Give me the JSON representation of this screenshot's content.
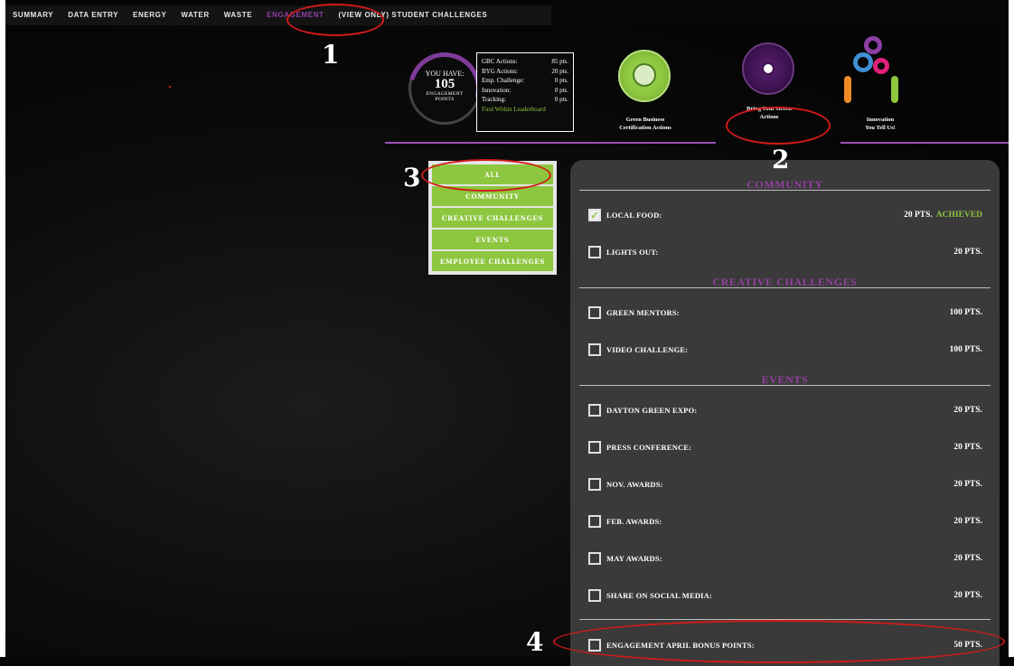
{
  "nav": {
    "tabs": [
      "SUMMARY",
      "DATA ENTRY",
      "ENERGY",
      "WATER",
      "WASTE",
      "ENGAGEMENT",
      "(VIEW ONLY) STUDENT CHALLENGES"
    ],
    "active_tab": "ENGAGEMENT"
  },
  "annotations": [
    "1",
    "2",
    "3",
    "4"
  ],
  "score": {
    "you_have": "YOU HAVE:",
    "points": "105",
    "unit_line1": "ENGAGEMENT",
    "unit_line2": "POINTS",
    "arc_fraction": 0.25
  },
  "breakdown": [
    {
      "label": "GBC Actions:",
      "value": "85 pts."
    },
    {
      "label": "BYG Actions:",
      "value": "20 pts."
    },
    {
      "label": "Emp. Challenge:",
      "value": "0 pts."
    },
    {
      "label": "Innovation:",
      "value": "0 pts."
    },
    {
      "label": "Tracking:",
      "value": "0 pts."
    }
  ],
  "leaderboard_link": "Find Within Leaderboard",
  "categories": [
    {
      "line1": "Green Business",
      "line2": "Certification Actions"
    },
    {
      "line1": "Bring Your Green",
      "line2": "Actions"
    },
    {
      "line1": "Innovation",
      "line2": "You Tell Us!"
    }
  ],
  "filters": [
    "ALL",
    "COMMUNITY",
    "CREATIVE CHALLENGES",
    "EVENTS",
    "EMPLOYEE CHALLENGES"
  ],
  "sections": {
    "community": {
      "title": "COMMUNITY",
      "items": [
        {
          "label": "LOCAL FOOD:",
          "pts": "20 PTS.",
          "status": "ACHIEVED",
          "checked": true
        },
        {
          "label": "LIGHTS OUT:",
          "pts": "20 PTS."
        }
      ]
    },
    "creative": {
      "title": "CREATIVE CHALLENGES",
      "items": [
        {
          "label": "GREEN MENTORS:",
          "pts": "100 PTS."
        },
        {
          "label": "VIDEO CHALLENGE:",
          "pts": "100 PTS."
        }
      ]
    },
    "events": {
      "title": "EVENTS",
      "items": [
        {
          "label": "DAYTON GREEN EXPO:",
          "pts": "20 PTS."
        },
        {
          "label": "PRESS CONFERENCE:",
          "pts": "20 PTS."
        },
        {
          "label": "NOV. AWARDS:",
          "pts": "20 PTS."
        },
        {
          "label": "FEB. AWARDS:",
          "pts": "20 PTS."
        },
        {
          "label": "MAY AWARDS:",
          "pts": "20 PTS."
        },
        {
          "label": "SHARE ON SOCIAL MEDIA:",
          "pts": "20 PTS."
        },
        {
          "label": "ENGAGEMENT APRIL BONUS POINTS:",
          "pts": "50 PTS."
        }
      ]
    }
  },
  "colors": {
    "purple": "#93419f",
    "green": "#8dc63f",
    "annotation_red": "#d21a1a",
    "panel": "#3a3a3a"
  }
}
